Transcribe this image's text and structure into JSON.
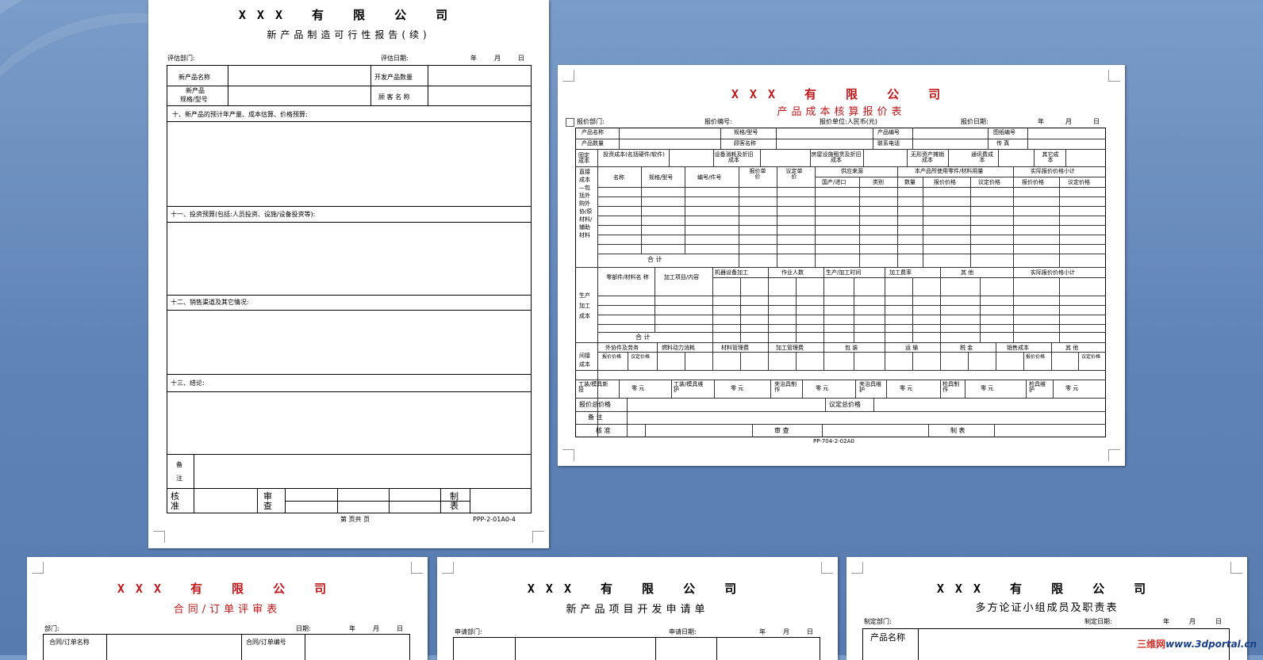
{
  "page1": {
    "company": "XXX 有 限 公 司",
    "subtitle": "新产品制造可行性报告(续)",
    "dept_label": "评估部门:",
    "date_label": "评估日期:",
    "year": "年",
    "month": "月",
    "day": "日",
    "product_name_label": "新产品名称",
    "dev_qty_label": "开发产品数量",
    "spec_label_1": "新产品",
    "spec_label_2": "规格/型号",
    "customer_label": "顾 客 名 称",
    "sec10": "十、新产品的预计年产量、成本估算、价格预算:",
    "sec11": "十一、投资预算(包括:人员投资、设施/设备投资等):",
    "sec12": "十二、销售渠道及其它情况:",
    "sec13": "十三、结论:",
    "remarks_1": "备",
    "remarks_2": "注",
    "approve": "核准",
    "review": "审查",
    "prepare": "制表",
    "footer": "第  页共  页",
    "code": "PPP-2-01A0-4"
  },
  "page2": {
    "company": "XXX 有 限 公 司",
    "subtitle": "产品成本核算报价表",
    "dept_label": "报价部门:",
    "no_label": "报价编号:",
    "unit_label": "报价单位:人民币(元)",
    "date_label": "报价日期:",
    "year": "年",
    "month": "月",
    "day": "日",
    "row1": [
      "产品名称",
      "规格/型号",
      "产品编号",
      "图纸编号"
    ],
    "row2": [
      "产品数量",
      "顾客名称",
      "联系电话",
      "传 真"
    ],
    "fixed_cost": "固定成本",
    "fixed_items": [
      "投资成本(名括硬件/软件)",
      "设备消耗及折旧成本",
      "房屋设施租赁及折旧成本",
      "无形资产摊销成本",
      "通讯费成本",
      "其它成本"
    ],
    "direct_cost": "直接成本—包括外购外协/原材料/辅助材料",
    "direct_headers": [
      "名称",
      "规格/型号",
      "编号/件号",
      "报价单价",
      "议定单价",
      "供应来源",
      "本产品所使用零件/材料用量",
      "实际报价价格小计"
    ],
    "direct_sub": [
      "国产/进口",
      "类别",
      "数量",
      "报价价格",
      "议定价格",
      "报价价格",
      "议定价格"
    ],
    "subtotal": "合  计",
    "production_cost": "生产加工成本",
    "prod_headers": [
      "零部件/材料名  称",
      "加工项目/内容",
      "机器设备加工",
      "作业人数",
      "生产/加工时间",
      "加工费率",
      "其  他",
      "实际报价价格小计"
    ],
    "indirect_cost": "间接成本",
    "indirect_headers": [
      "外协件及劳务",
      "燃料动力消耗",
      "材料管理费",
      "加工管理费",
      "包  装",
      "运  输",
      "税  金",
      "销售成本",
      "其  他"
    ],
    "price_pair": [
      "报价价格",
      "议定价格"
    ],
    "fixture_row": [
      "工装/模具新投",
      "工装/模具维护",
      "夹治具制作",
      "夹治具维护",
      "检具制作",
      "检具维护"
    ],
    "zero_yuan": "零  元",
    "total_quote": "报价总价格",
    "agreed_total": "议定总价格",
    "remarks": "备  注",
    "approve": "核  准",
    "review": "审  查",
    "prepare": "制  表",
    "code": "PP-704-2-02A0"
  },
  "page3": {
    "company": "XXX 有 限 公 司",
    "subtitle": "合同/订单评审表",
    "dept_label": "部门:",
    "date_label": "日期:",
    "year": "年",
    "month": "月",
    "day": "日",
    "contract_name": "合同/订单名称",
    "contract_no": "合同/订单编号"
  },
  "page4": {
    "company": "XXX 有 限 公 司",
    "subtitle": "新产品项目开发申请单",
    "dept_label": "申请部门:",
    "date_label": "申请日期:",
    "year": "年",
    "month": "月",
    "day": "日"
  },
  "page5": {
    "company": "XXX 有 限 公 司",
    "subtitle": "多方论证小组成员及职责表",
    "dept_label": "制定部门:",
    "date_label": "制定日期:",
    "year": "年",
    "month": "月",
    "day": "日",
    "product_name": "产品名称"
  },
  "watermark": {
    "brand": "三维网",
    "url": "www.3dportal.cn"
  },
  "colors": {
    "background": "#6a8fc0",
    "title_red": "#c0171a"
  }
}
